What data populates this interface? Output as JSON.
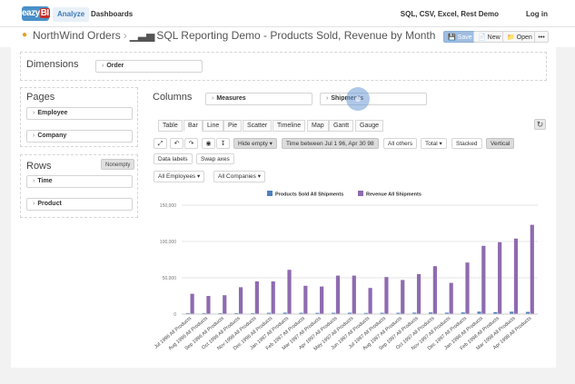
{
  "topbar": {
    "logo": {
      "pre": "eazy",
      "bi": "BI"
    },
    "nav": [
      "Analyze",
      "Dashboards"
    ],
    "right": "SQL, CSV, Excel, Rest Demo",
    "login": "Log in"
  },
  "header": {
    "crumb": "NorthWind Orders",
    "report": "SQL Reporting Demo - Products Sold, Revenue by Month",
    "save": "Save",
    "new": "New",
    "open": "Open",
    "more": "•••"
  },
  "dimensions": {
    "title": "Dimensions",
    "chip": "Order"
  },
  "columns": {
    "title": "Columns",
    "chips": [
      "Measures",
      "Shipments"
    ]
  },
  "pages": {
    "title": "Pages",
    "chips": [
      "Employee",
      "Company"
    ]
  },
  "rows": {
    "title": "Rows",
    "nonempty": "Nonempty",
    "chips": [
      "Time",
      "Product"
    ]
  },
  "tabs": [
    "Table",
    "Bar",
    "Line",
    "Pie",
    "Scatter",
    "Timeline",
    "Map",
    "Gantt",
    "Gauge"
  ],
  "toolbar": {
    "hide_empty": "Hide empty ▾",
    "time_filter": "Time between Jul 1 96, Apr 30 98",
    "all_others": "All others",
    "total": "Total ▾",
    "stacked": "Stacked",
    "vertical": "Vertical",
    "data_labels": "Data labels",
    "swap_axes": "Swap axes",
    "employees": "All Employees ▾",
    "companies": "All Companies ▾"
  },
  "chart_data": {
    "type": "bar",
    "title": "",
    "xlabel": "",
    "ylabel": "",
    "ylim": [
      0,
      150000
    ],
    "yticks": [
      "0",
      "50,000",
      "100,000",
      "150,000"
    ],
    "legend": "top-center",
    "categories": [
      "Jul 1996 All Products",
      "Aug 1996 All Products",
      "Sep 1996 All Products",
      "Oct 1996 All Products",
      "Nov 1996 All Products",
      "Dec 1996 All Products",
      "Jan 1997 All Products",
      "Feb 1997 All Products",
      "Mar 1997 All Products",
      "Apr 1997 All Products",
      "May 1997 All Products",
      "Jun 1997 All Products",
      "Jul 1997 All Products",
      "Aug 1997 All Products",
      "Sep 1997 All Products",
      "Oct 1997 All Products",
      "Nov 1997 All Products",
      "Dec 1997 All Products",
      "Jan 1998 All Products",
      "Feb 1998 All Products",
      "Mar 1998 All Products",
      "Apr 1998 All Products"
    ],
    "series": [
      {
        "name": "Products Sold All Shipments",
        "color": "#4f7fbf",
        "values": [
          1400,
          1400,
          1300,
          1400,
          1300,
          1800,
          2000,
          1800,
          1700,
          1800,
          1900,
          1600,
          1800,
          1800,
          2000,
          2300,
          2000,
          2300,
          3400,
          2700,
          3300,
          3000
        ]
      },
      {
        "name": "Revenue All Shipments",
        "color": "#8e6bb0",
        "values": [
          28000,
          25000,
          26000,
          37000,
          45000,
          45000,
          61000,
          39000,
          38000,
          53000,
          53000,
          36000,
          51000,
          47000,
          55000,
          66000,
          43000,
          71000,
          94000,
          99000,
          104000,
          123000
        ]
      }
    ]
  }
}
